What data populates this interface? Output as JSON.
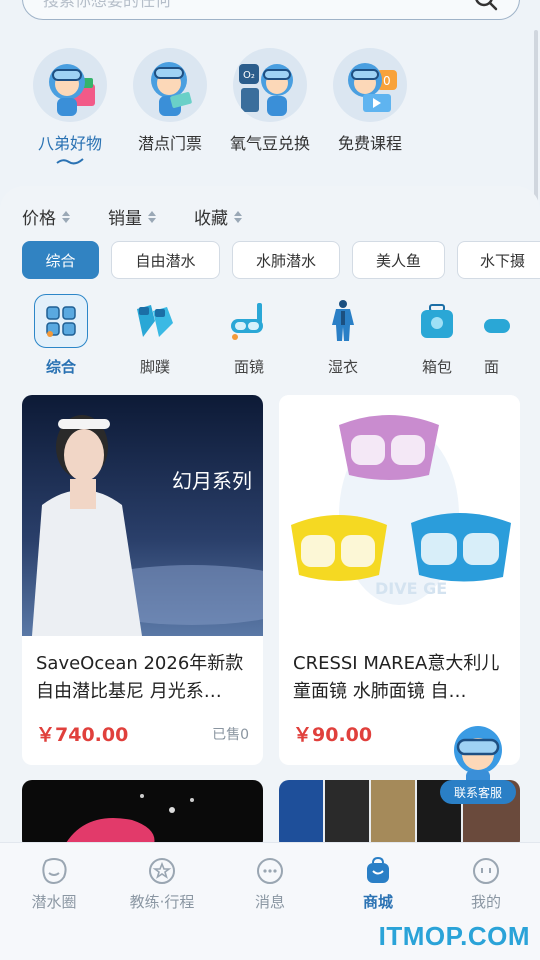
{
  "search": {
    "placeholder": "搜索你想要的任何"
  },
  "top_categories": [
    {
      "label": "八弟好物",
      "icon": "mascot-gifts-icon",
      "active": true
    },
    {
      "label": "潜点门票",
      "icon": "mascot-ticket-icon",
      "active": false
    },
    {
      "label": "氧气豆兑换",
      "icon": "mascot-oxygen-icon",
      "active": false
    },
    {
      "label": "免费课程",
      "icon": "mascot-course-icon",
      "active": false
    }
  ],
  "sort": [
    {
      "label": "价格"
    },
    {
      "label": "销量"
    },
    {
      "label": "收藏"
    }
  ],
  "chips": [
    {
      "label": "综合",
      "active": true
    },
    {
      "label": "自由潜水",
      "active": false
    },
    {
      "label": "水肺潜水",
      "active": false
    },
    {
      "label": "美人鱼",
      "active": false
    },
    {
      "label": "水下摄",
      "active": false
    }
  ],
  "subcategories": [
    {
      "label": "综合",
      "icon": "grid-icon",
      "active": true
    },
    {
      "label": "脚蹼",
      "icon": "fins-icon",
      "active": false
    },
    {
      "label": "面镜",
      "icon": "mask-icon",
      "active": false
    },
    {
      "label": "湿衣",
      "icon": "wetsuit-icon",
      "active": false
    },
    {
      "label": "箱包",
      "icon": "bag-icon",
      "active": false
    },
    {
      "label": "面",
      "icon": "partial-icon",
      "active": false
    }
  ],
  "products": [
    {
      "title": "SaveOcean 2026年新款自由潜比基尼 月光系…",
      "price": "￥740.00",
      "sold": "已售0",
      "image_text": "幻月系列"
    },
    {
      "title": "CRESSI MAREA意大利儿童面镜 水肺面镜 自…",
      "price": "￥90.00",
      "sold": "",
      "image_text": "DIVE GE"
    }
  ],
  "support": {
    "label": "联系客服"
  },
  "bottom_nav": [
    {
      "label": "潜水圈",
      "icon": "bubble-icon",
      "active": false
    },
    {
      "label": "教练·行程",
      "icon": "star-icon",
      "active": false
    },
    {
      "label": "消息",
      "icon": "chat-icon",
      "active": false
    },
    {
      "label": "商城",
      "icon": "shop-bag-icon",
      "active": true
    },
    {
      "label": "我的",
      "icon": "profile-face-icon",
      "active": false
    }
  ],
  "watermark": "ITMOP.COM",
  "colors": {
    "accent": "#3183c2",
    "price": "#e0403c",
    "active_text": "#2a72b3"
  }
}
